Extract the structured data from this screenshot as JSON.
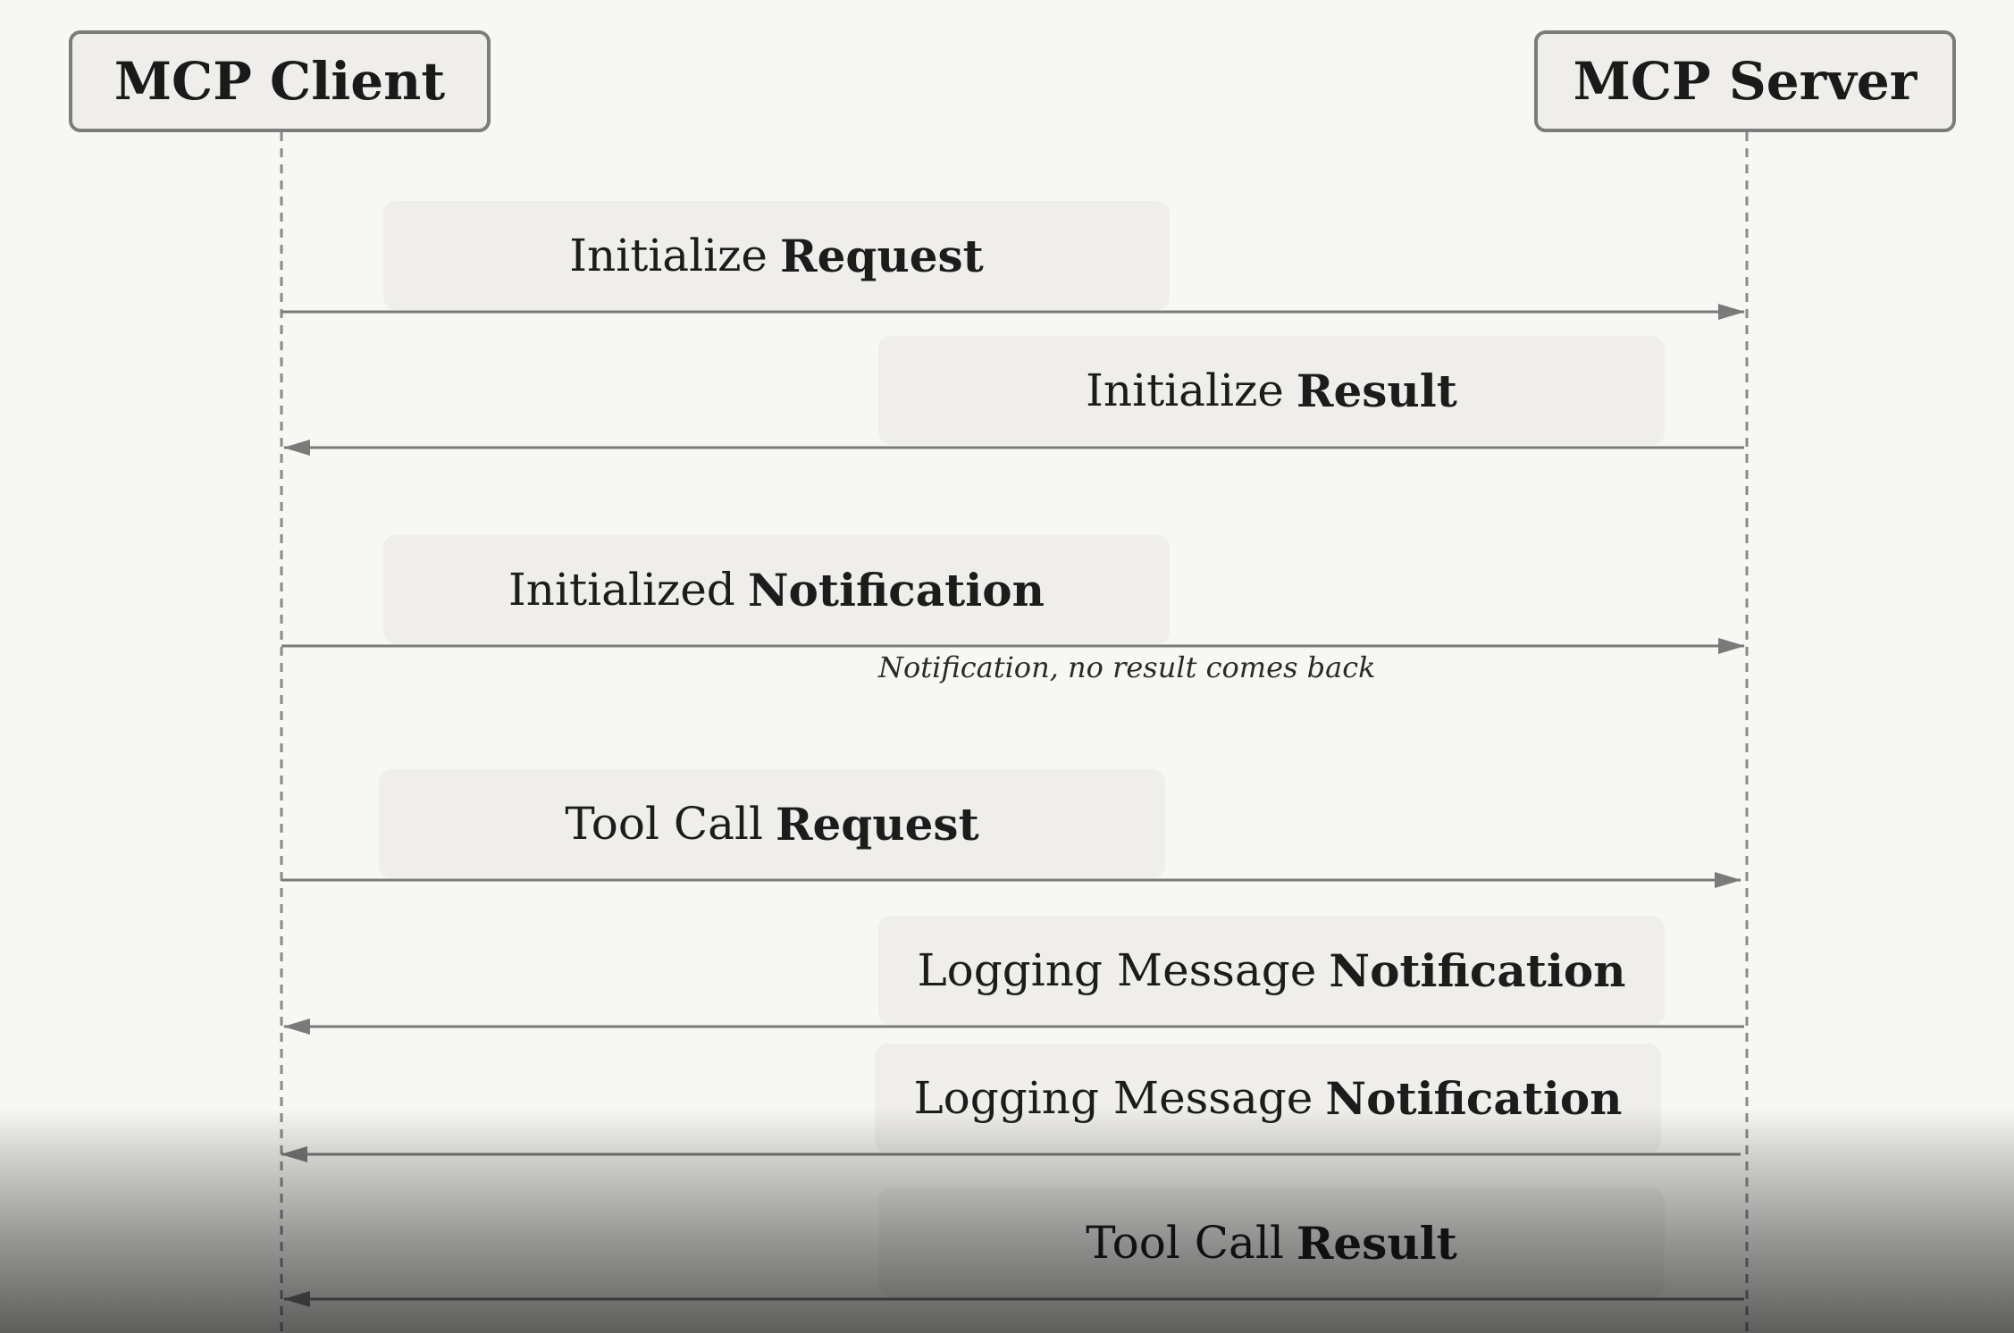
{
  "actors": {
    "client": "MCP Client",
    "server": "MCP Server"
  },
  "messages": [
    {
      "plain": "Initialize",
      "strong": "Request",
      "direction": "client-to-server"
    },
    {
      "plain": "Initialize",
      "strong": "Result",
      "direction": "server-to-client"
    },
    {
      "plain": "Initialized",
      "strong": "Notification",
      "direction": "client-to-server",
      "note": "Notification, no result comes back"
    },
    {
      "plain": "Tool Call",
      "strong": "Request",
      "direction": "client-to-server"
    },
    {
      "plain": "Logging Message",
      "strong": "Notification",
      "direction": "server-to-client"
    },
    {
      "plain": "Logging Message",
      "strong": "Notification",
      "direction": "server-to-client"
    },
    {
      "plain": "Tool Call",
      "strong": "Result",
      "direction": "server-to-client"
    }
  ],
  "colors": {
    "background": "#f7f8f4",
    "box_fill": "#efeeeb",
    "actor_border": "#7c7c7c",
    "arrow": "#7a7a7a",
    "lifeline": "#8a8a8a"
  }
}
